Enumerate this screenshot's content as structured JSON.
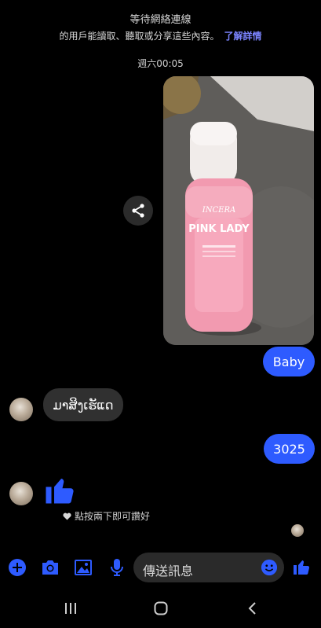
{
  "notice": {
    "line1": "等待網絡連線",
    "line2": "的用戶能讀取、聽取或分享這些內容。",
    "link": "了解詳情"
  },
  "timestamp": "週六00:05",
  "photo": {
    "bottle_brand": "INCERA",
    "bottle_title": "PINK LADY"
  },
  "messages": [
    {
      "side": "out",
      "text": "Baby"
    },
    {
      "side": "in",
      "text": "ມາສິງເຮັແດ"
    },
    {
      "side": "out",
      "text": "3025"
    },
    {
      "side": "in",
      "type": "like",
      "icon": "thumbs-up-icon"
    }
  ],
  "reaction_hint": "點按兩下即可讚好",
  "composer": {
    "placeholder": "傳送訊息",
    "icons": [
      "plus-icon",
      "camera-icon",
      "image-icon",
      "microphone-icon",
      "emoji-icon",
      "thumbs-up-icon"
    ]
  },
  "navbar": {
    "icons": [
      "recents-icon",
      "home-icon",
      "back-icon"
    ]
  },
  "colors": {
    "accent": "#2e5bff",
    "link": "#7b84ff",
    "incoming_bubble": "#303030",
    "background": "#000000"
  }
}
